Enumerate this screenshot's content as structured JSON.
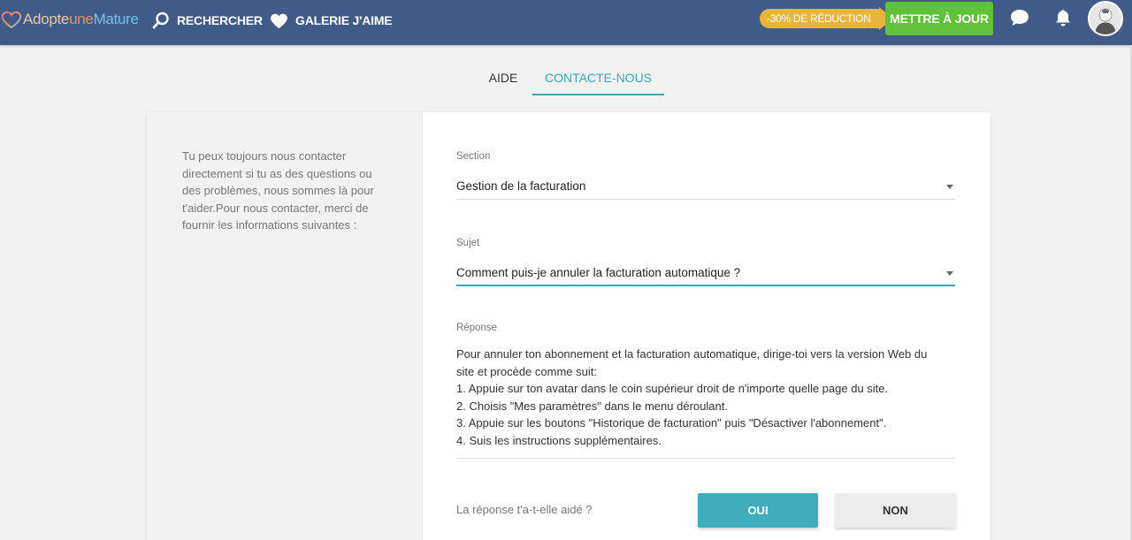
{
  "header": {
    "logo": {
      "part1": "Adopte",
      "part2": "une",
      "part3": "Mature"
    },
    "nav": [
      {
        "label": "RECHERCHER",
        "icon": "search-icon"
      },
      {
        "label": "GALERIE J'AIME",
        "icon": "heart-icon"
      }
    ],
    "promo": "-30% DE RÉDUCTION",
    "upgrade_label": "METTRE À JOUR",
    "icons": [
      "chat-icon",
      "bell-icon",
      "avatar"
    ]
  },
  "tabs": [
    {
      "label": "AIDE",
      "active": false
    },
    {
      "label": "CONTACTE-NOUS",
      "active": true
    }
  ],
  "contact": {
    "intro": "Tu peux toujours nous contacter directement si tu as des questions ou des problèmes, nous sommes là pour t'aider.Pour nous contacter, merci de fournir les informations suivantes :",
    "section_label": "Section",
    "section_value": "Gestion de la facturation",
    "subject_label": "Sujet",
    "subject_value": "Comment puis-je annuler la facturation automatique ?",
    "answer_label": "Réponse",
    "answer_lines": [
      "Pour annuler ton abonnement et la facturation automatique, dirige-toi vers la version Web du",
      "site et procède comme suit:",
      "1. Appuie sur ton avatar dans le coin supérieur droit de n'importe quelle page du site.",
      "2. Choisis \"Mes paramètres\" dans le menu déroulant.",
      "3. Appuie sur les boutons \"Historique de facturation\" puis \"Désactiver l'abonnement\".",
      "4. Suis les instructions supplémentaires."
    ],
    "helped_question": "La réponse t'a-t-elle aidé ?",
    "yes_label": "OUI",
    "no_label": "NON"
  },
  "colors": {
    "header_bg": "#415b88",
    "accent": "#3aa6b4",
    "upgrade": "#60c13a",
    "promo": "#e9b43c"
  }
}
